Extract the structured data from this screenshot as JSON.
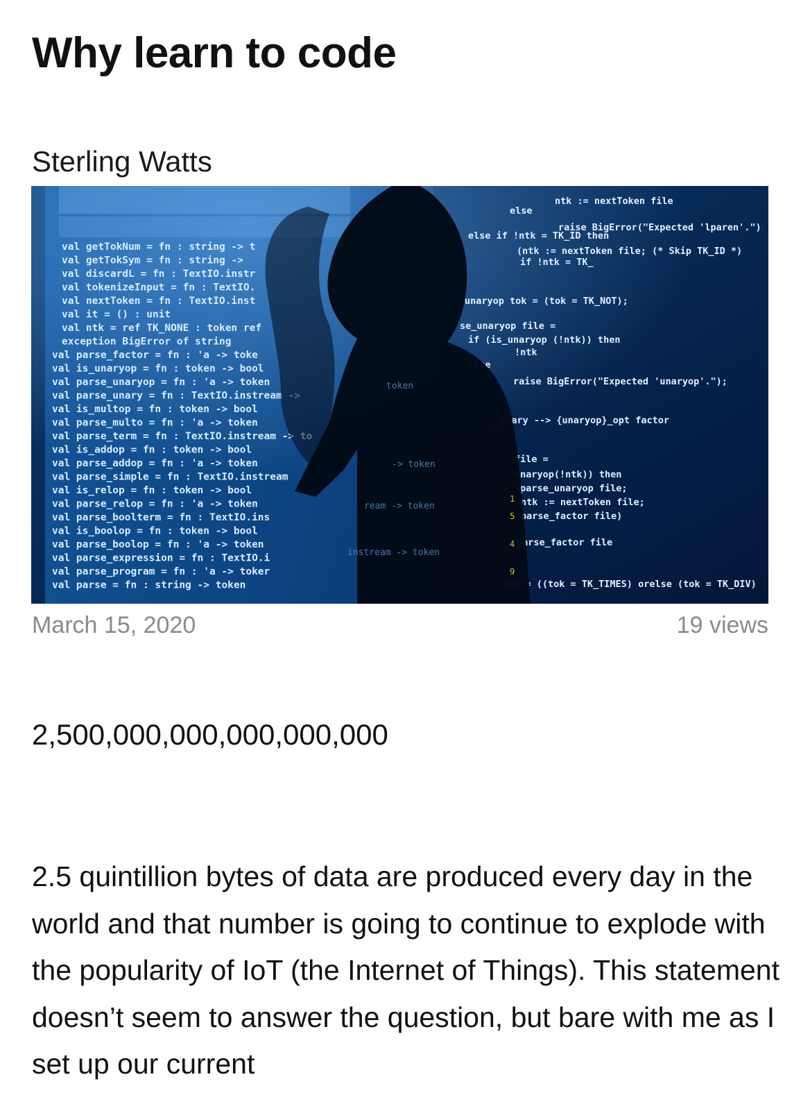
{
  "article": {
    "title": "Why learn to code",
    "author": "Sterling Watts",
    "date": "March 15, 2020",
    "views": "19 views",
    "headline_number": "2,500,000,000,000,000,000",
    "paragraph": "2.5 quintillion bytes of data are produced every day in the world and that number is going to continue to explode with the popularity of IoT (the Internet of Things). This statement doesn’t seem to answer the question, but bare with me as I set up our current"
  },
  "hero_image": {
    "description_icon": "photo-icon",
    "colors": {
      "background": "#041c3f",
      "code_left": "#cfe9ff",
      "code_right": "#dfeeff",
      "highlight": "#ffd84a",
      "silhouette": "#020a16"
    },
    "left_code_lines": [
      "val getTokNum = fn : string -> t",
      "val getTokSym = fn : string -> ",
      "val discardL = fn : TextIO.instr",
      "val tokenizeInput = fn : TextIO.",
      "val nextToken = fn : TextIO.inst",
      "val it = () : unit",
      "val ntk = ref TK_NONE : token ref",
      "exception BigError of string",
      "val parse_factor = fn : 'a -> toke",
      "val is_unaryop = fn : token -> bool",
      "val parse_unaryop = fn : 'a -> token",
      "val parse_unary = fn : TextIO.instream ->",
      "val is_multop = fn : token -> bool",
      "val parse_multo = fn : 'a -> token",
      "val parse_term = fn : TextIO.instream -> to",
      "val is_addop = fn : token -> bool",
      "val parse_addop = fn : 'a -> token",
      "val parse_simple = fn : TextIO.instream",
      "val is_relop = fn : token -> bool",
      "val parse_relop = fn : 'a -> token",
      "val parse_boolterm = fn : TextIO.ins",
      "val is_boolop = fn : token -> bool",
      "val parse_boolop = fn : 'a -> token",
      "val parse_expression = fn : TextIO.i",
      "val parse_program = fn : 'a -> toker",
      "val parse = fn : string -> token"
    ],
    "right_code_lines": [
      "ntk := nextToken file",
      "else",
      "raise BigError(\"Expected 'lparen'.\")",
      "else if !ntk = TK_ID then",
      "(ntk := nextToken file; (* Skip TK_ID *)",
      "if !ntk = TK_",
      "unaryop tok = (tok = TK_NOT);",
      "se_unaryop file =",
      "if (is_unaryop (!ntk)) then",
      "!ntk",
      "else",
      "raise BigError(\"Expected 'unaryop'.\");",
      "_unary --> {unaryop}_opt factor",
      "file =",
      "unaryop(!ntk)) then",
      "(parse_unaryop file;",
      "ntk := nextToken file;",
      "parse_factor file)",
      "parse_factor file",
      "tok = ((tok = TK_TIMES) orelse (tok = TK_DIV)"
    ]
  }
}
